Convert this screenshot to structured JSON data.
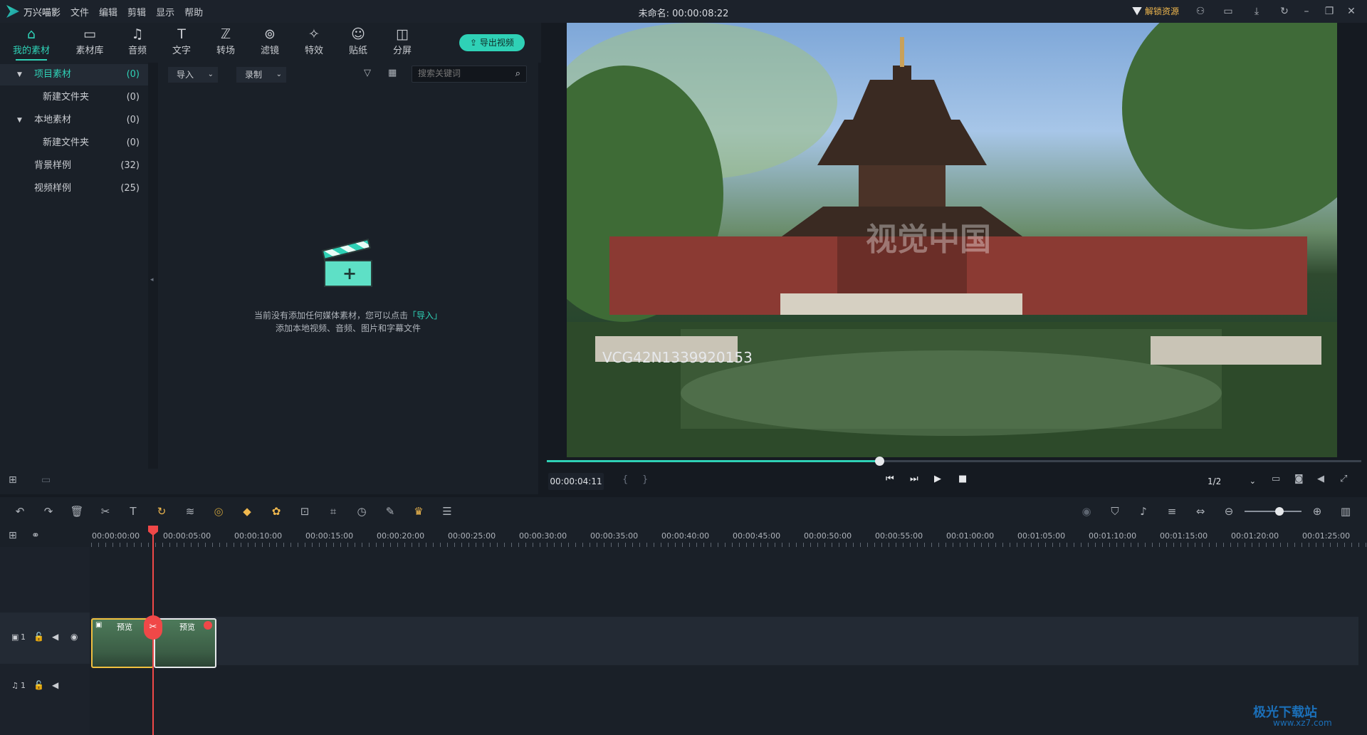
{
  "app": {
    "name": "万兴喵影",
    "menus": [
      "文件",
      "编辑",
      "剪辑",
      "显示",
      "帮助"
    ],
    "project_title": "未命名: 00:00:08:22",
    "unlock_label": "解锁资源"
  },
  "tabs": [
    {
      "label": "我的素材",
      "icon": "folder-box-icon",
      "active": true
    },
    {
      "label": "素材库",
      "icon": "folder-icon"
    },
    {
      "label": "音频",
      "icon": "music-note-icon"
    },
    {
      "label": "文字",
      "icon": "text-icon"
    },
    {
      "label": "转场",
      "icon": "transition-icon"
    },
    {
      "label": "滤镜",
      "icon": "filter-icon"
    },
    {
      "label": "特效",
      "icon": "effects-icon"
    },
    {
      "label": "贴纸",
      "icon": "sticker-icon"
    },
    {
      "label": "分屏",
      "icon": "split-screen-icon"
    }
  ],
  "export_label": "导出视频",
  "tree": [
    {
      "label": "项目素材",
      "count": "(0)",
      "selected": true,
      "expand": true
    },
    {
      "label": "新建文件夹",
      "count": "(0)",
      "indent": true
    },
    {
      "label": "本地素材",
      "count": "(0)",
      "expand": true
    },
    {
      "label": "新建文件夹",
      "count": "(0)",
      "indent": true
    },
    {
      "label": "背景样例",
      "count": "(32)"
    },
    {
      "label": "视频样例",
      "count": "(25)"
    }
  ],
  "media": {
    "import_label": "导入",
    "record_label": "录制",
    "search_placeholder": "搜索关键词",
    "empty_line1_a": "当前没有添加任何媒体素材，您可以点击",
    "empty_line1_link": "「导入」",
    "empty_line2": "添加本地视频、音频、图片和字幕文件"
  },
  "preview": {
    "watermark": "VCG42N1339920153",
    "watermark2": "视觉中国",
    "timecode": "00:00:04:11",
    "quality": "1/2",
    "progress": 0.408
  },
  "timeline": {
    "ruler": [
      "00:00:00:00",
      "00:00:05:00",
      "00:00:10:00",
      "00:00:15:00",
      "00:00:20:00",
      "00:00:25:00",
      "00:00:30:00",
      "00:00:35:00",
      "00:00:40:00",
      "00:00:45:00",
      "00:00:50:00",
      "00:00:55:00",
      "00:01:00:00",
      "00:01:05:00",
      "00:01:10:00",
      "00:01:15:00",
      "00:01:20:00",
      "00:01:25:00"
    ],
    "video_track_label": "1",
    "audio_track_label": "1",
    "clips": [
      "预览",
      "预览"
    ]
  },
  "site_watermark": {
    "name": "极光下载站",
    "url": "www.xz7.com"
  }
}
